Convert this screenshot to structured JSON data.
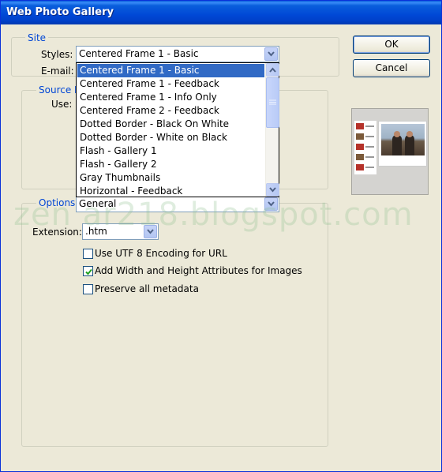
{
  "window": {
    "title": "Web Photo Gallery"
  },
  "site": {
    "legend": "Site",
    "styles_label": "Styles:",
    "styles_value": "Centered Frame 1 - Basic",
    "email_label": "E-mail:"
  },
  "styles_list": {
    "items": [
      "Centered Frame 1 - Basic",
      "Centered Frame 1 - Feedback",
      "Centered Frame 1 - Info Only",
      "Centered Frame 2 - Feedback",
      "Dotted Border - Black On White",
      "Dotted Border - White on Black",
      "Flash - Gallery 1",
      "Flash - Gallery 2",
      "Gray Thumbnails",
      "Horizontal - Feedback"
    ],
    "selected_index": 0
  },
  "source": {
    "legend": "Source I",
    "use_label": "Use:"
  },
  "options": {
    "legend": "Options:",
    "value": "General",
    "extension_label": "Extension:",
    "extension_value": ".htm",
    "utf8_label": "Use UTF 8 Encoding for URL",
    "utf8_checked": false,
    "wh_label": "Add Width and Height Attributes for Images",
    "wh_checked": true,
    "metadata_label": "Preserve all metadata",
    "metadata_checked": false
  },
  "buttons": {
    "ok": "OK",
    "cancel": "Cancel"
  },
  "watermark": "zen ar218.blogspot.com",
  "icons": {
    "dropdown": "chevron-down-icon",
    "check": "check-icon"
  },
  "colors": {
    "titlebar": "#0a5fdc",
    "selection": "#316ac5",
    "legend": "#0046d5",
    "dialog": "#ece9d8"
  }
}
